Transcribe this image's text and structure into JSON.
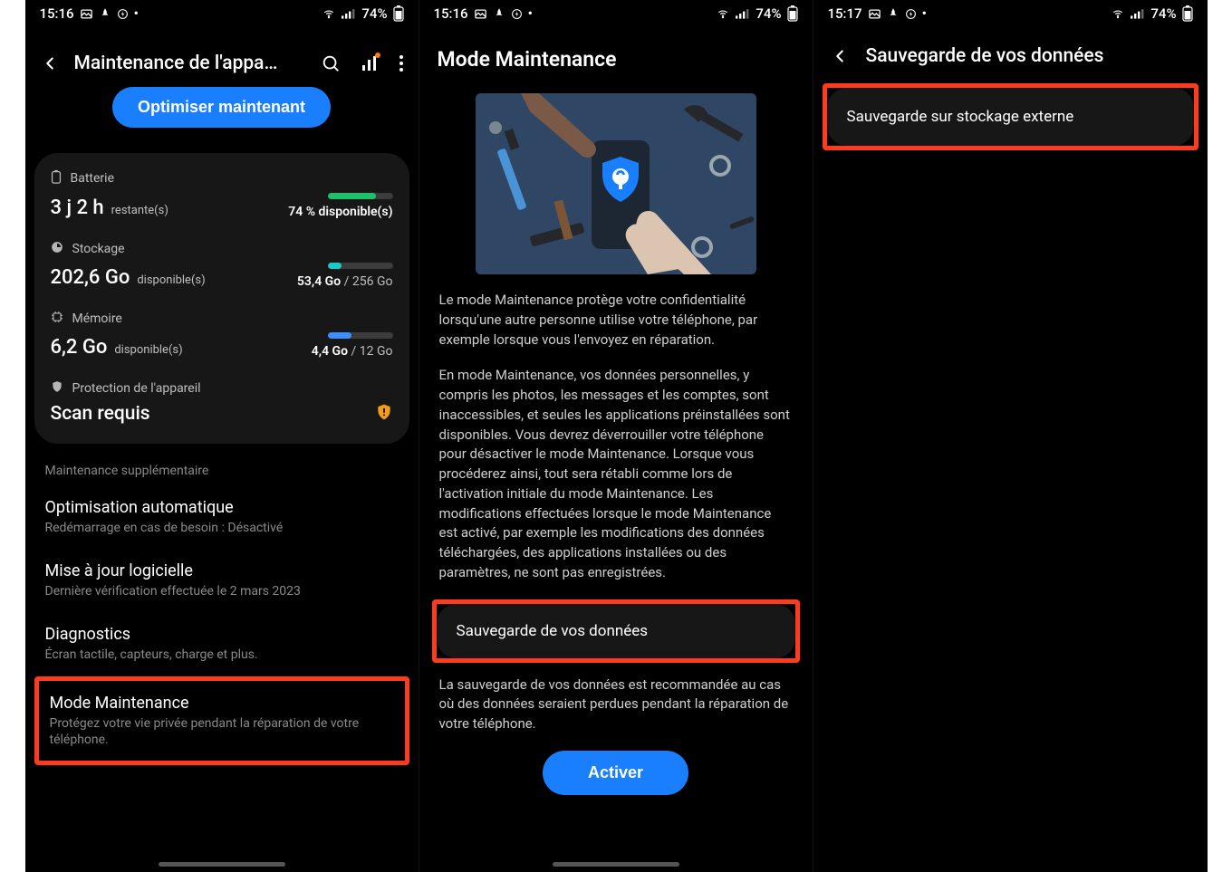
{
  "statusbar": {
    "time1": "15:16",
    "time2": "15:16",
    "time3": "15:17",
    "battery_text": "74%"
  },
  "phone1": {
    "title": "Maintenance de l'appa…",
    "optimize": "Optimiser maintenant",
    "battery": {
      "label": "Batterie",
      "value": "3 j 2 h",
      "remaining": "restante(s)",
      "available": "74 % disponible(s)",
      "percent": 74
    },
    "storage": {
      "label": "Stockage",
      "value": "202,6 Go",
      "avail": "disponible(s)",
      "used": "53,4 Go",
      "total": "256 Go",
      "percent": 21
    },
    "memory": {
      "label": "Mémoire",
      "value": "6,2 Go",
      "avail": "disponible(s)",
      "used": "4,4 Go",
      "total": "12 Go",
      "percent": 37
    },
    "protection": {
      "label": "Protection de l'appareil",
      "status": "Scan requis"
    },
    "extra_label": "Maintenance supplémentaire",
    "auto_opt": {
      "title": "Optimisation automatique",
      "sub": "Redémarrage en cas de besoin : Désactivé"
    },
    "software": {
      "title": "Mise à jour logicielle",
      "sub": "Dernière vérification effectuée le 2 mars 2023"
    },
    "diagnostics": {
      "title": "Diagnostics",
      "sub": "Écran tactile, capteurs, charge et plus."
    },
    "maint_mode": {
      "title": "Mode Maintenance",
      "sub": "Protégez votre vie privée pendant la réparation de votre téléphone."
    }
  },
  "phone2": {
    "title": "Mode Maintenance",
    "para1": "Le mode Maintenance protège votre confidentialité lorsqu'une autre personne utilise votre téléphone, par exemple lorsque vous l'envoyez en réparation.",
    "para2": "En mode Maintenance, vos données personnelles, y compris les photos, les messages et les comptes, sont inaccessibles, et seules les applications préinstallées sont disponibles. Vous devrez déverrouiller votre téléphone pour désactiver le mode Maintenance. Lorsque vous procéderez ainsi, tout sera rétabli comme lors de l'activation initiale du mode Maintenance. Les modifications effectuées lorsque le mode Maintenance est activé, par exemple les modifications des données téléchargées, des applications installées ou des paramètres, ne sont pas enregistrées.",
    "backup_card": "Sauvegarde de vos données",
    "para3": "La sauvegarde de vos données est recommandée au cas où des données seraient perdues pendant la réparation de votre téléphone.",
    "activate": "Activer"
  },
  "phone3": {
    "title": "Sauvegarde de vos données",
    "ext_backup": "Sauvegarde sur stockage externe"
  }
}
